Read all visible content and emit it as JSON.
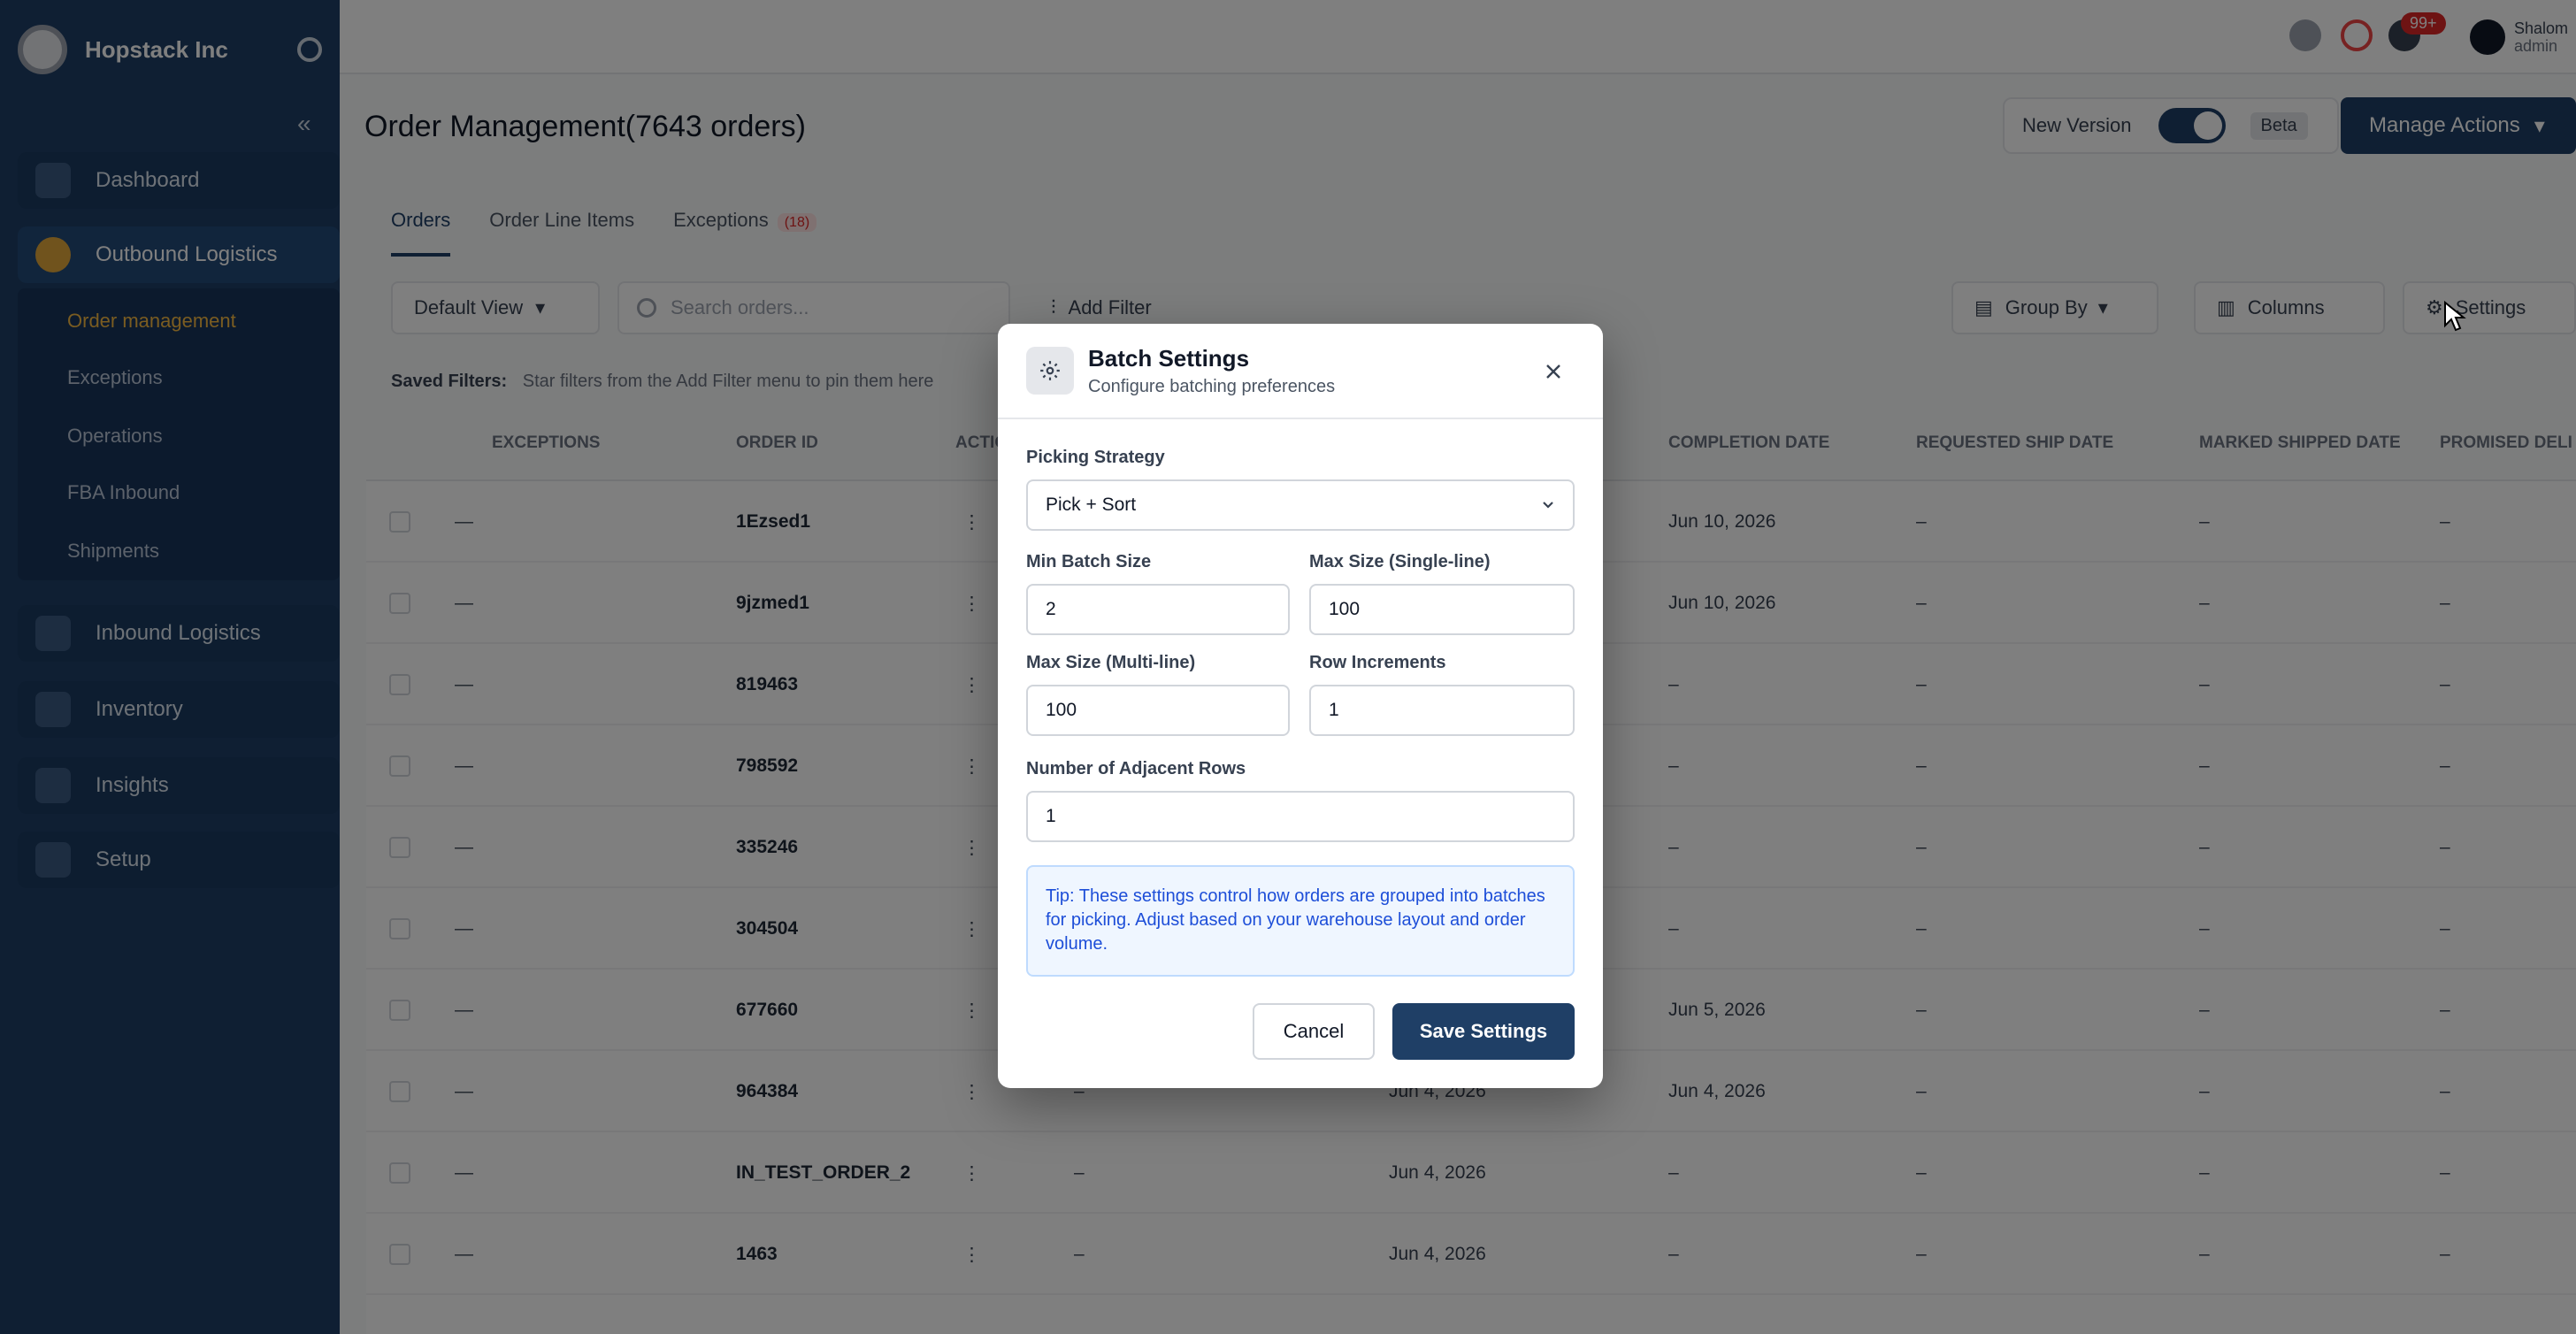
{
  "sidebar": {
    "company": "Hopstack Inc",
    "collapse_icon": "«",
    "items": [
      {
        "label": "Dashboard"
      },
      {
        "label": "Outbound Logistics"
      },
      {
        "label": "Inbound Logistics"
      },
      {
        "label": "Inventory"
      },
      {
        "label": "Insights"
      },
      {
        "label": "Setup"
      }
    ],
    "subitems": [
      {
        "label": "Order management"
      },
      {
        "label": "Exceptions"
      },
      {
        "label": "Operations"
      },
      {
        "label": "FBA Inbound"
      },
      {
        "label": "Shipments"
      }
    ]
  },
  "topbar": {
    "notification_count": "99+",
    "user_name": "Shalom",
    "user_role": "admin"
  },
  "header": {
    "title": "Order Management(7643 orders)",
    "view_version_label": "New Version",
    "beta_label": "Beta",
    "manage_actions_label": "Manage Actions"
  },
  "tabs": [
    {
      "label": "Orders"
    },
    {
      "label": "Order Line Items"
    },
    {
      "label": "Exceptions",
      "count": "(18)"
    }
  ],
  "toolbar": {
    "default_view_label": "Default View",
    "search_placeholder": "Search orders...",
    "add_filter_label": "Add Filter",
    "group_by_label": "Group By",
    "columns_label": "Columns",
    "settings_label": "Settings"
  },
  "saved_filters": {
    "label": "Saved Filters:",
    "hint": "Star filters from the Add Filter menu to pin them here"
  },
  "table": {
    "columns": [
      "EXCEPTIONS",
      "ORDER ID",
      "ACTIONS",
      "COMPLETION DATE",
      "REQUESTED SHIP DATE",
      "MARKED SHIPPED DATE",
      "PROMISED DELI"
    ],
    "rows": [
      {
        "exceptions": "—",
        "order_id": "1Ezsed1",
        "actions": "⋮",
        "status": "",
        "order_date": "",
        "completion_date": "Jun 10, 2026",
        "requested": "–",
        "marked": "–",
        "promised": "–"
      },
      {
        "exceptions": "—",
        "order_id": "9jzmed1",
        "actions": "⋮",
        "status": "",
        "order_date": "",
        "completion_date": "Jun 10, 2026",
        "requested": "–",
        "marked": "–",
        "promised": "–"
      },
      {
        "exceptions": "—",
        "order_id": "819463",
        "actions": "⋮",
        "status": "",
        "order_date": "",
        "completion_date": "–",
        "requested": "–",
        "marked": "–",
        "promised": "–"
      },
      {
        "exceptions": "—",
        "order_id": "798592",
        "actions": "⋮",
        "status": "",
        "order_date": "",
        "completion_date": "–",
        "requested": "–",
        "marked": "–",
        "promised": "–"
      },
      {
        "exceptions": "—",
        "order_id": "335246",
        "actions": "⋮",
        "status": "",
        "order_date": "",
        "completion_date": "–",
        "requested": "–",
        "marked": "–",
        "promised": "–"
      },
      {
        "exceptions": "—",
        "order_id": "304504",
        "actions": "⋮",
        "status": "",
        "order_date": "",
        "completion_date": "–",
        "requested": "–",
        "marked": "–",
        "promised": "–"
      },
      {
        "exceptions": "—",
        "order_id": "677660",
        "actions": "⋮",
        "status": "",
        "order_date": "",
        "completion_date": "Jun 5, 2026",
        "requested": "–",
        "marked": "–",
        "promised": "–"
      },
      {
        "exceptions": "—",
        "order_id": "964384",
        "actions": "⋮",
        "status": "–",
        "order_date": "Jun 4, 2026",
        "completion_date": "Jun 4, 2026",
        "requested": "–",
        "marked": "–",
        "promised": "–"
      },
      {
        "exceptions": "—",
        "order_id": "IN_TEST_ORDER_2",
        "actions": "⋮",
        "status": "–",
        "order_date": "Jun 4, 2026",
        "completion_date": "–",
        "requested": "–",
        "marked": "–",
        "promised": "–"
      },
      {
        "exceptions": "—",
        "order_id": "1463",
        "actions": "⋮",
        "status": "–",
        "order_date": "Jun 4, 2026",
        "completion_date": "–",
        "requested": "–",
        "marked": "–",
        "promised": "–"
      }
    ]
  },
  "modal": {
    "title": "Batch Settings",
    "subtitle": "Configure batching preferences",
    "close_icon": "×",
    "picking_strategy_label": "Picking Strategy",
    "picking_strategy_value": "Pick + Sort",
    "min_batch_label": "Min Batch Size",
    "min_batch_value": "2",
    "max_single_label": "Max Size (Single-line)",
    "max_single_value": "100",
    "max_multi_label": "Max Size (Multi-line)",
    "max_multi_value": "100",
    "row_increments_label": "Row Increments",
    "row_increments_value": "1",
    "adjacent_rows_label": "Number of Adjacent Rows",
    "adjacent_rows_value": "1",
    "tip": "Tip: These settings control how orders are grouped into batches for picking. Adjust based on your warehouse layout and order volume.",
    "cancel_label": "Cancel",
    "save_label": "Save Settings"
  },
  "colors": {
    "primary": "#1f3f66",
    "sidebar_bg": "#1f3f66",
    "tip_bg": "#eff6ff",
    "tip_text": "#1d4ed8",
    "accent": "#e0a63b"
  }
}
